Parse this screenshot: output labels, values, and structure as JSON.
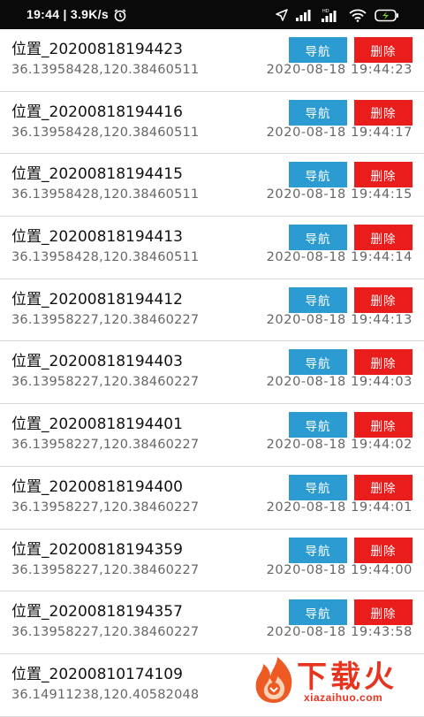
{
  "status_bar": {
    "time_speed": "19:44 | 3.9K/s",
    "icons": [
      "alarm-icon",
      "location-arrow-icon",
      "signal-icon",
      "signal-hd-icon",
      "wifi-icon",
      "battery-charging-icon"
    ]
  },
  "buttons": {
    "navigate": "导航",
    "delete": "删除"
  },
  "rows": [
    {
      "name": "位置_20200818194423",
      "coords": "36.13958428,120.38460511",
      "time": "2020-08-18 19:44:23"
    },
    {
      "name": "位置_20200818194416",
      "coords": "36.13958428,120.38460511",
      "time": "2020-08-18 19:44:17"
    },
    {
      "name": "位置_20200818194415",
      "coords": "36.13958428,120.38460511",
      "time": "2020-08-18 19:44:15"
    },
    {
      "name": "位置_20200818194413",
      "coords": "36.13958428,120.38460511",
      "time": "2020-08-18 19:44:14"
    },
    {
      "name": "位置_20200818194412",
      "coords": "36.13958227,120.38460227",
      "time": "2020-08-18 19:44:13"
    },
    {
      "name": "位置_20200818194403",
      "coords": "36.13958227,120.38460227",
      "time": "2020-08-18 19:44:03"
    },
    {
      "name": "位置_20200818194401",
      "coords": "36.13958227,120.38460227",
      "time": "2020-08-18 19:44:02"
    },
    {
      "name": "位置_20200818194400",
      "coords": "36.13958227,120.38460227",
      "time": "2020-08-18 19:44:01"
    },
    {
      "name": "位置_20200818194359",
      "coords": "36.13958227,120.38460227",
      "time": "2020-08-18 19:44:00"
    },
    {
      "name": "位置_20200818194357",
      "coords": "36.13958227,120.38460227",
      "time": "2020-08-18 19:43:58"
    },
    {
      "name": "位置_20200810174109",
      "coords": "36.14911238,120.40582048",
      "time": ""
    }
  ],
  "watermark": {
    "title": "下载火",
    "subtitle": "xiazaihuo.com"
  },
  "colors": {
    "navigate_button": "#2b9bd1",
    "delete_button": "#ea1d1d",
    "watermark": "#e8341f"
  }
}
